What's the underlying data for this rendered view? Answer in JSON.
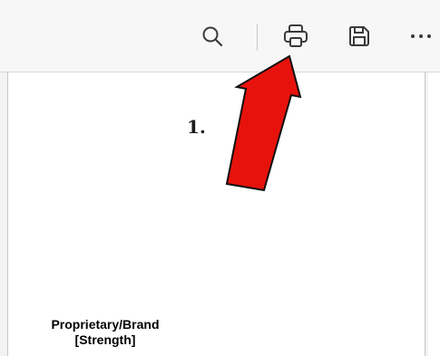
{
  "toolbar": {
    "buttons": [
      {
        "icon": "search-icon"
      },
      {
        "icon": "print-icon"
      },
      {
        "icon": "save-icon"
      },
      {
        "icon": "more-icon"
      }
    ]
  },
  "annotation": {
    "step_label": "1.",
    "arrow_color": "#e8120c"
  },
  "document": {
    "heading_line1": "Proprietary/Brand",
    "heading_line2": "[Strength]"
  }
}
